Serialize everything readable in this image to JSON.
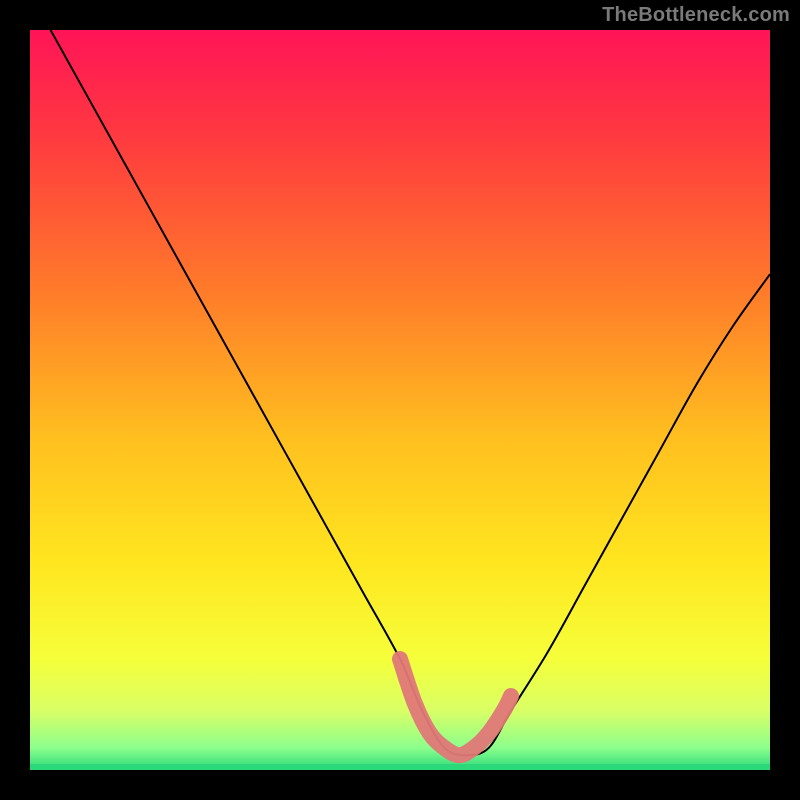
{
  "watermark": "TheBottleneck.com",
  "chart_data": {
    "type": "line",
    "title": "",
    "xlabel": "",
    "ylabel": "",
    "xlim": [
      0,
      100
    ],
    "ylim": [
      0,
      100
    ],
    "series": [
      {
        "name": "bottleneck-curve",
        "x": [
          0,
          5,
          10,
          15,
          20,
          25,
          30,
          35,
          40,
          45,
          50,
          53,
          56,
          59,
          62,
          65,
          70,
          75,
          80,
          85,
          90,
          95,
          100
        ],
        "y": [
          105,
          96,
          87,
          78,
          69,
          60,
          51,
          42,
          33,
          24,
          15,
          8,
          3,
          2,
          3,
          8,
          16,
          25,
          34,
          43,
          52,
          60,
          67
        ]
      }
    ],
    "highlight": {
      "name": "bottom-chip-region",
      "color": "#e07878",
      "x": [
        50,
        52,
        54,
        56,
        58,
        60,
        62,
        64,
        65
      ],
      "y": [
        15,
        9,
        5,
        3,
        2,
        3,
        5,
        8,
        10
      ]
    },
    "gradient_stops": [
      {
        "offset": 0.0,
        "color": "#ff1457"
      },
      {
        "offset": 0.15,
        "color": "#ff3b3f"
      },
      {
        "offset": 0.35,
        "color": "#ff7a2a"
      },
      {
        "offset": 0.55,
        "color": "#ffbf1f"
      },
      {
        "offset": 0.72,
        "color": "#ffe61f"
      },
      {
        "offset": 0.85,
        "color": "#f5ff3a"
      },
      {
        "offset": 0.92,
        "color": "#d9ff66"
      },
      {
        "offset": 0.97,
        "color": "#8cff8c"
      },
      {
        "offset": 1.0,
        "color": "#2bd97b"
      }
    ]
  }
}
